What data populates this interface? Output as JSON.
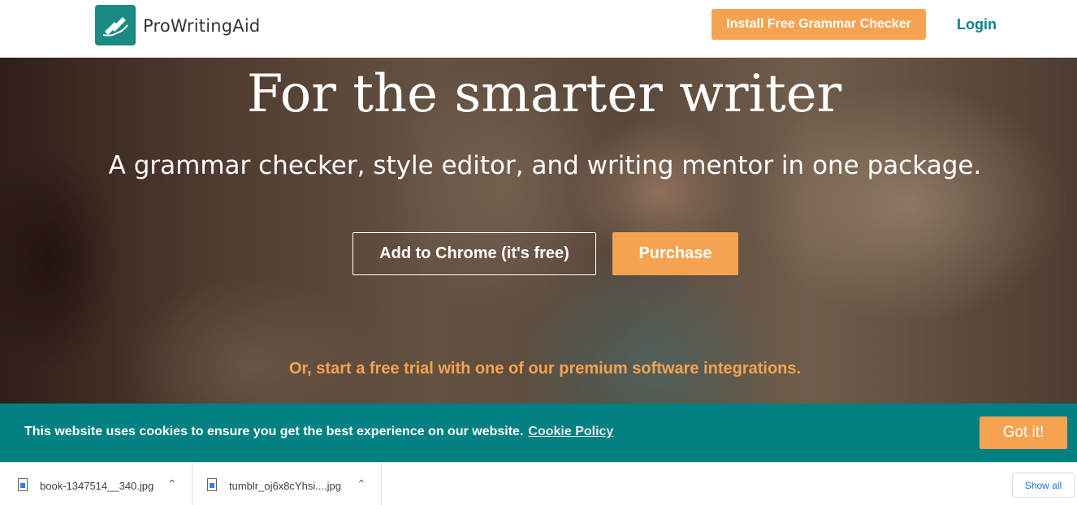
{
  "header": {
    "brand": "ProWritingAid",
    "install_button": "Install Free Grammar Checker",
    "login": "Login"
  },
  "hero": {
    "title": "For the smarter writer",
    "subtitle": "A grammar checker, style editor, and writing mentor in one package.",
    "chrome_button": "Add to Chrome (it's free)",
    "purchase_button": "Purchase",
    "trial_link": "Or, start a free trial with one of our premium software integrations."
  },
  "cookie": {
    "message": "This website uses cookies to ensure you get the best experience on our website.",
    "policy_link": "Cookie Policy",
    "accept_button": "Got it!"
  },
  "downloads": {
    "items": [
      {
        "name": "book-1347514__340.jpg",
        "icon": "image-file-icon"
      },
      {
        "name": "tumblr_oj6x8cYhsi....jpg",
        "icon": "image-file-icon"
      }
    ],
    "show_all": "Show all"
  },
  "colors": {
    "accent_orange": "#f5a351",
    "brand_teal": "#1a8a82",
    "cookie_bg": "#038081",
    "link_teal": "#0e7f8a"
  }
}
